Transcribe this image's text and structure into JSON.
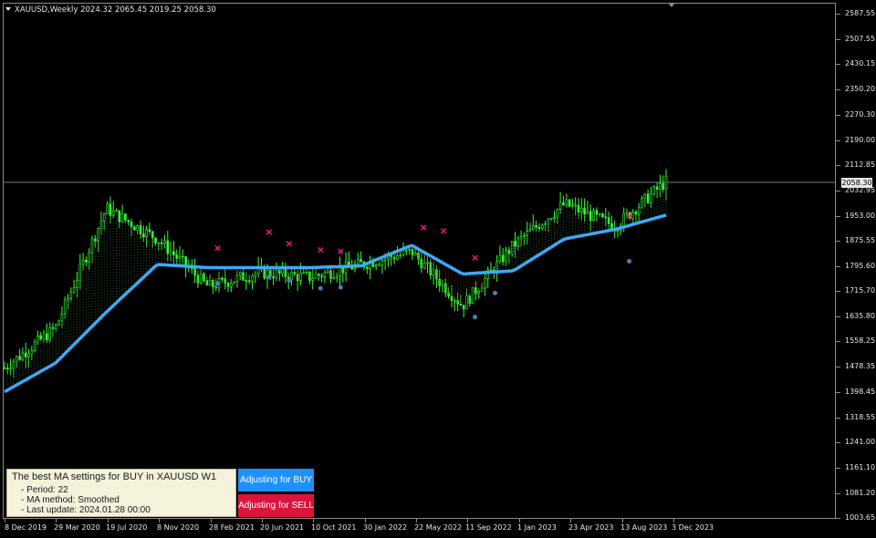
{
  "header": {
    "title": "XAUUSD,Weekly  2024.32 2065.45 2019.25 2058.30"
  },
  "price_axis": {
    "labels": [
      "2587.55",
      "2507.55",
      "2430.15",
      "2350.20",
      "2270.30",
      "2190.00",
      "2112.85",
      "2032.95",
      "1953.00",
      "1875.55",
      "1795.60",
      "1715.70",
      "1635.80",
      "1558.25",
      "1478.35",
      "1398.45",
      "1318.55",
      "1241.00",
      "1161.10",
      "1081.20",
      "1003.65"
    ],
    "current_price": "2058.30"
  },
  "time_axis": {
    "labels": [
      "8 Dec 2019",
      "29 Mar 2020",
      "19 Jul 2020",
      "8 Nov 2020",
      "28 Feb 2021",
      "20 Jun 2021",
      "10 Oct 2021",
      "30 Jan 2022",
      "22 May 2022",
      "11 Sep 2022",
      "1 Jan 2023",
      "23 Apr 2023",
      "13 Aug 2023",
      "3 Dec 2023"
    ]
  },
  "info_panel": {
    "title": "The best MA settings for BUY in XAUUSD W1",
    "period": "- Period: 22",
    "method": "- MA method: Smoothed",
    "last_update": "- Last update: 2024.01.28 00:00"
  },
  "buttons": {
    "buy_label": "Adjusting for BUY",
    "sell_label": "Adjusting for SELL"
  },
  "colors": {
    "background": "#000000",
    "candle": "#33ff33",
    "moving_average": "#3fa9f5",
    "sell_marker": "#ff1a8c",
    "buy_marker": "#4a7fb5",
    "grid_text": "#e6e6e6",
    "buy_button": "#1e90ff",
    "sell_button": "#dc143c",
    "panel_background": "#f5f2dc"
  },
  "chart_data": {
    "type": "line",
    "symbol": "XAUUSD",
    "timeframe": "Weekly",
    "ohlc_last": {
      "open": 2024.32,
      "high": 2065.45,
      "low": 2019.25,
      "close": 2058.3
    },
    "ylim": [
      1003.65,
      2587.55
    ],
    "x": [
      "8 Dec 2019",
      "29 Mar 2020",
      "19 Jul 2020",
      "8 Nov 2020",
      "28 Feb 2021",
      "20 Jun 2021",
      "10 Oct 2021",
      "30 Jan 2022",
      "22 May 2022",
      "11 Sep 2022",
      "1 Jan 2023",
      "23 Apr 2023",
      "13 Aug 2023",
      "3 Dec 2023"
    ],
    "series": [
      {
        "name": "Price",
        "values": [
          1475,
          1600,
          1975,
          1880,
          1730,
          1775,
          1760,
          1800,
          1840,
          1670,
          1860,
          1990,
          1920,
          2060
        ]
      },
      {
        "values": [
          1400,
          1490,
          1650,
          1800,
          1790,
          1790,
          1790,
          1795,
          1860,
          1770,
          1780,
          1880,
          1910,
          1955
        ]
      }
    ],
    "sell_signals": [
      {
        "date": "28 Feb 2021",
        "price": 1850
      },
      {
        "date": "20 Jun 2021",
        "price": 1900
      },
      {
        "date": "20 Jun 2021",
        "price": 1865
      },
      {
        "date": "10 Oct 2021",
        "price": 1845
      },
      {
        "date": "10 Oct 2021",
        "price": 1840
      },
      {
        "date": "22 May 2022",
        "price": 1915
      },
      {
        "date": "22 May 2022",
        "price": 1905
      },
      {
        "date": "11 Sep 2022",
        "price": 1820
      },
      {
        "date": "13 Aug 2023",
        "price": 1950
      }
    ],
    "buy_signals": [
      {
        "date": "28 Feb 2021",
        "price": 1740
      },
      {
        "date": "20 Jun 2021",
        "price": 1760
      },
      {
        "date": "20 Jun 2021",
        "price": 1750
      },
      {
        "date": "10 Oct 2021",
        "price": 1725
      },
      {
        "date": "10 Oct 2021",
        "price": 1728
      },
      {
        "date": "11 Sep 2022",
        "price": 1635
      },
      {
        "date": "11 Sep 2022",
        "price": 1710
      },
      {
        "date": "13 Aug 2023",
        "price": 1810
      }
    ]
  }
}
